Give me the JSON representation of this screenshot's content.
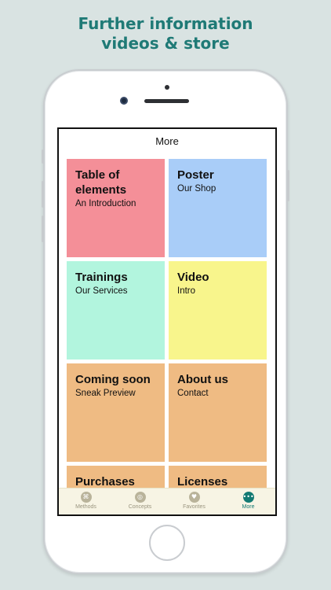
{
  "headline": {
    "line1": "Further information",
    "line2": "videos & store"
  },
  "navbar": {
    "title": "More"
  },
  "tiles": [
    {
      "title": "Table of elements",
      "subtitle": "An Introduction",
      "color": "#f48f98"
    },
    {
      "title": "Poster",
      "subtitle": "Our Shop",
      "color": "#a9cdf8"
    },
    {
      "title": "Trainings",
      "subtitle": "Our Services",
      "color": "#b2f5de"
    },
    {
      "title": "Video",
      "subtitle": "Intro",
      "color": "#f8f58c"
    },
    {
      "title": "Coming soon",
      "subtitle": "Sneak Preview",
      "color": "#efbb83"
    },
    {
      "title": "About us",
      "subtitle": "Contact",
      "color": "#efbb83"
    },
    {
      "title": "Purchases",
      "subtitle": "",
      "color": "#efbb83"
    },
    {
      "title": "Licenses",
      "subtitle": "",
      "color": "#efbb83"
    }
  ],
  "tabbar": [
    {
      "label": "Methods",
      "icon": "methods-icon"
    },
    {
      "label": "Concepts",
      "icon": "concepts-icon"
    },
    {
      "label": "Favorites",
      "icon": "heart-icon"
    },
    {
      "label": "More",
      "icon": "more-icon",
      "active": true
    }
  ],
  "colors": {
    "accent": "#137a73",
    "headline": "#1f7a76",
    "background": "#d9e3e2"
  }
}
